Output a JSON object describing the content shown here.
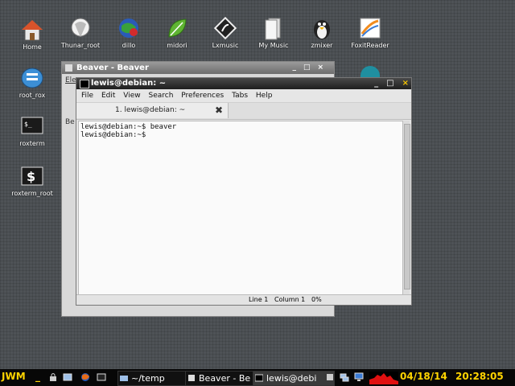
{
  "desktop": {
    "icons": [
      {
        "label": "Home",
        "icon": "home-icon"
      },
      {
        "label": "Thunar_root",
        "icon": "thunar-icon"
      },
      {
        "label": "dillo",
        "icon": "dillo-icon"
      },
      {
        "label": "midori",
        "icon": "midori-icon"
      },
      {
        "label": "Lxmusic",
        "icon": "lxmusic-icon"
      },
      {
        "label": "My Music",
        "icon": "my-music-icon"
      },
      {
        "label": "zmixer",
        "icon": "zmixer-icon"
      },
      {
        "label": "FoxitReader",
        "icon": "foxit-icon"
      },
      {
        "label": "root_rox",
        "icon": "rox-icon"
      },
      {
        "label": "roxterm",
        "icon": "roxterm-icon"
      },
      {
        "label": "roxterm_root",
        "icon": "roxterm-root-icon"
      }
    ]
  },
  "beaver": {
    "title": "Beaver - Beaver",
    "menu_fragment": "Ele",
    "side_fragment": "Be"
  },
  "terminal": {
    "title": "lewis@debian: ~",
    "menu": [
      "File",
      "Edit",
      "View",
      "Search",
      "Preferences",
      "Tabs",
      "Help"
    ],
    "tab_label": "1. lewis@debian: ~",
    "lines": [
      "lewis@debian:~$ beaver",
      "lewis@debian:~$"
    ],
    "status": {
      "line": "Line 1",
      "column": "Column 1",
      "percent": "0%"
    }
  },
  "taskbar": {
    "start_label": "JWM",
    "tasks": [
      {
        "label": "~/temp"
      },
      {
        "label": "Beaver - Be"
      },
      {
        "label": "lewis@debi"
      }
    ],
    "date": "04/18/14",
    "time": "20:28:05"
  },
  "colors": {
    "accent": "#ffd400",
    "close_button": "#f5c400",
    "desktop": "#4e5256"
  }
}
